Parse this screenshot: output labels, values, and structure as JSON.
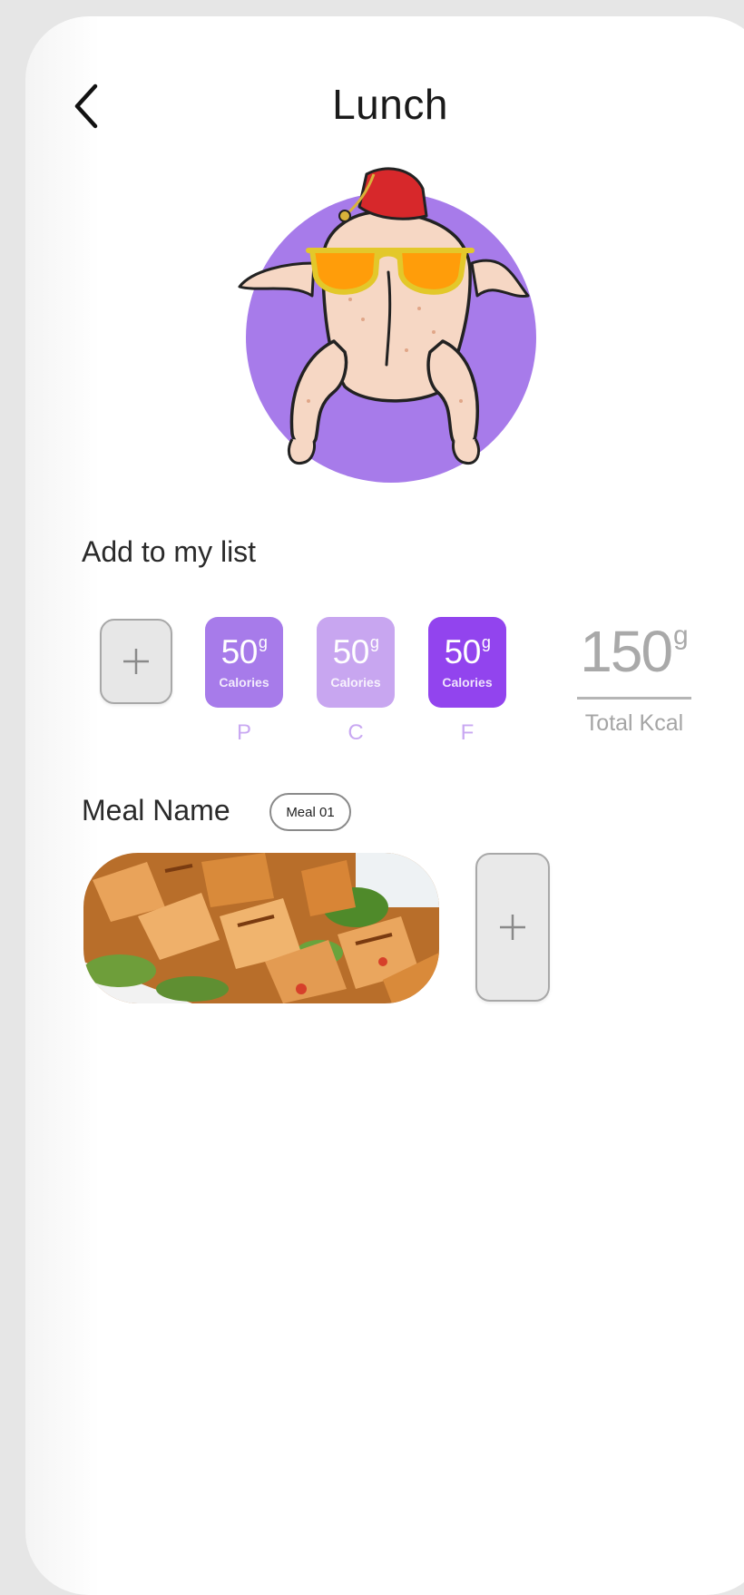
{
  "header": {
    "title": "Lunch"
  },
  "add_section": {
    "label": "Add to my list",
    "add_symbol": "+"
  },
  "macros": [
    {
      "value": "50",
      "unit": "g",
      "sublabel": "Calories",
      "letter": "P",
      "color": "#a77bea"
    },
    {
      "value": "50",
      "unit": "g",
      "sublabel": "Calories",
      "letter": "C",
      "color": "#c8a6f0"
    },
    {
      "value": "50",
      "unit": "g",
      "sublabel": "Calories",
      "letter": "F",
      "color": "#9244ee"
    }
  ],
  "total": {
    "value": "150",
    "unit": "g",
    "label": "Total Kcal"
  },
  "meal": {
    "label": "Meal Name",
    "badge": "Meal 01",
    "add_symbol": "+"
  },
  "icons": {
    "back": "chevron-left-icon",
    "add": "plus-icon"
  },
  "colors": {
    "accent_purple": "#9244ee",
    "hero_circle": "#a77bea"
  }
}
